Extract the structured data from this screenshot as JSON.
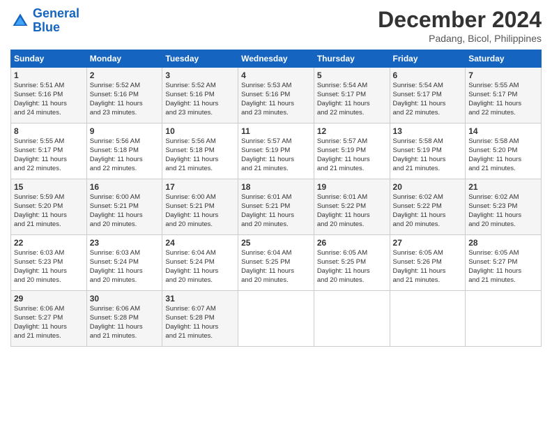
{
  "logo": {
    "line1": "General",
    "line2": "Blue"
  },
  "title": "December 2024",
  "subtitle": "Padang, Bicol, Philippines",
  "days_header": [
    "Sunday",
    "Monday",
    "Tuesday",
    "Wednesday",
    "Thursday",
    "Friday",
    "Saturday"
  ],
  "weeks": [
    [
      {
        "day": "1",
        "info": "Sunrise: 5:51 AM\nSunset: 5:16 PM\nDaylight: 11 hours\nand 24 minutes."
      },
      {
        "day": "2",
        "info": "Sunrise: 5:52 AM\nSunset: 5:16 PM\nDaylight: 11 hours\nand 23 minutes."
      },
      {
        "day": "3",
        "info": "Sunrise: 5:52 AM\nSunset: 5:16 PM\nDaylight: 11 hours\nand 23 minutes."
      },
      {
        "day": "4",
        "info": "Sunrise: 5:53 AM\nSunset: 5:16 PM\nDaylight: 11 hours\nand 23 minutes."
      },
      {
        "day": "5",
        "info": "Sunrise: 5:54 AM\nSunset: 5:17 PM\nDaylight: 11 hours\nand 22 minutes."
      },
      {
        "day": "6",
        "info": "Sunrise: 5:54 AM\nSunset: 5:17 PM\nDaylight: 11 hours\nand 22 minutes."
      },
      {
        "day": "7",
        "info": "Sunrise: 5:55 AM\nSunset: 5:17 PM\nDaylight: 11 hours\nand 22 minutes."
      }
    ],
    [
      {
        "day": "8",
        "info": "Sunrise: 5:55 AM\nSunset: 5:17 PM\nDaylight: 11 hours\nand 22 minutes."
      },
      {
        "day": "9",
        "info": "Sunrise: 5:56 AM\nSunset: 5:18 PM\nDaylight: 11 hours\nand 22 minutes."
      },
      {
        "day": "10",
        "info": "Sunrise: 5:56 AM\nSunset: 5:18 PM\nDaylight: 11 hours\nand 21 minutes."
      },
      {
        "day": "11",
        "info": "Sunrise: 5:57 AM\nSunset: 5:19 PM\nDaylight: 11 hours\nand 21 minutes."
      },
      {
        "day": "12",
        "info": "Sunrise: 5:57 AM\nSunset: 5:19 PM\nDaylight: 11 hours\nand 21 minutes."
      },
      {
        "day": "13",
        "info": "Sunrise: 5:58 AM\nSunset: 5:19 PM\nDaylight: 11 hours\nand 21 minutes."
      },
      {
        "day": "14",
        "info": "Sunrise: 5:58 AM\nSunset: 5:20 PM\nDaylight: 11 hours\nand 21 minutes."
      }
    ],
    [
      {
        "day": "15",
        "info": "Sunrise: 5:59 AM\nSunset: 5:20 PM\nDaylight: 11 hours\nand 21 minutes."
      },
      {
        "day": "16",
        "info": "Sunrise: 6:00 AM\nSunset: 5:21 PM\nDaylight: 11 hours\nand 20 minutes."
      },
      {
        "day": "17",
        "info": "Sunrise: 6:00 AM\nSunset: 5:21 PM\nDaylight: 11 hours\nand 20 minutes."
      },
      {
        "day": "18",
        "info": "Sunrise: 6:01 AM\nSunset: 5:21 PM\nDaylight: 11 hours\nand 20 minutes."
      },
      {
        "day": "19",
        "info": "Sunrise: 6:01 AM\nSunset: 5:22 PM\nDaylight: 11 hours\nand 20 minutes."
      },
      {
        "day": "20",
        "info": "Sunrise: 6:02 AM\nSunset: 5:22 PM\nDaylight: 11 hours\nand 20 minutes."
      },
      {
        "day": "21",
        "info": "Sunrise: 6:02 AM\nSunset: 5:23 PM\nDaylight: 11 hours\nand 20 minutes."
      }
    ],
    [
      {
        "day": "22",
        "info": "Sunrise: 6:03 AM\nSunset: 5:23 PM\nDaylight: 11 hours\nand 20 minutes."
      },
      {
        "day": "23",
        "info": "Sunrise: 6:03 AM\nSunset: 5:24 PM\nDaylight: 11 hours\nand 20 minutes."
      },
      {
        "day": "24",
        "info": "Sunrise: 6:04 AM\nSunset: 5:24 PM\nDaylight: 11 hours\nand 20 minutes."
      },
      {
        "day": "25",
        "info": "Sunrise: 6:04 AM\nSunset: 5:25 PM\nDaylight: 11 hours\nand 20 minutes."
      },
      {
        "day": "26",
        "info": "Sunrise: 6:05 AM\nSunset: 5:25 PM\nDaylight: 11 hours\nand 20 minutes."
      },
      {
        "day": "27",
        "info": "Sunrise: 6:05 AM\nSunset: 5:26 PM\nDaylight: 11 hours\nand 21 minutes."
      },
      {
        "day": "28",
        "info": "Sunrise: 6:05 AM\nSunset: 5:27 PM\nDaylight: 11 hours\nand 21 minutes."
      }
    ],
    [
      {
        "day": "29",
        "info": "Sunrise: 6:06 AM\nSunset: 5:27 PM\nDaylight: 11 hours\nand 21 minutes."
      },
      {
        "day": "30",
        "info": "Sunrise: 6:06 AM\nSunset: 5:28 PM\nDaylight: 11 hours\nand 21 minutes."
      },
      {
        "day": "31",
        "info": "Sunrise: 6:07 AM\nSunset: 5:28 PM\nDaylight: 11 hours\nand 21 minutes."
      },
      {
        "day": "",
        "info": ""
      },
      {
        "day": "",
        "info": ""
      },
      {
        "day": "",
        "info": ""
      },
      {
        "day": "",
        "info": ""
      }
    ]
  ]
}
